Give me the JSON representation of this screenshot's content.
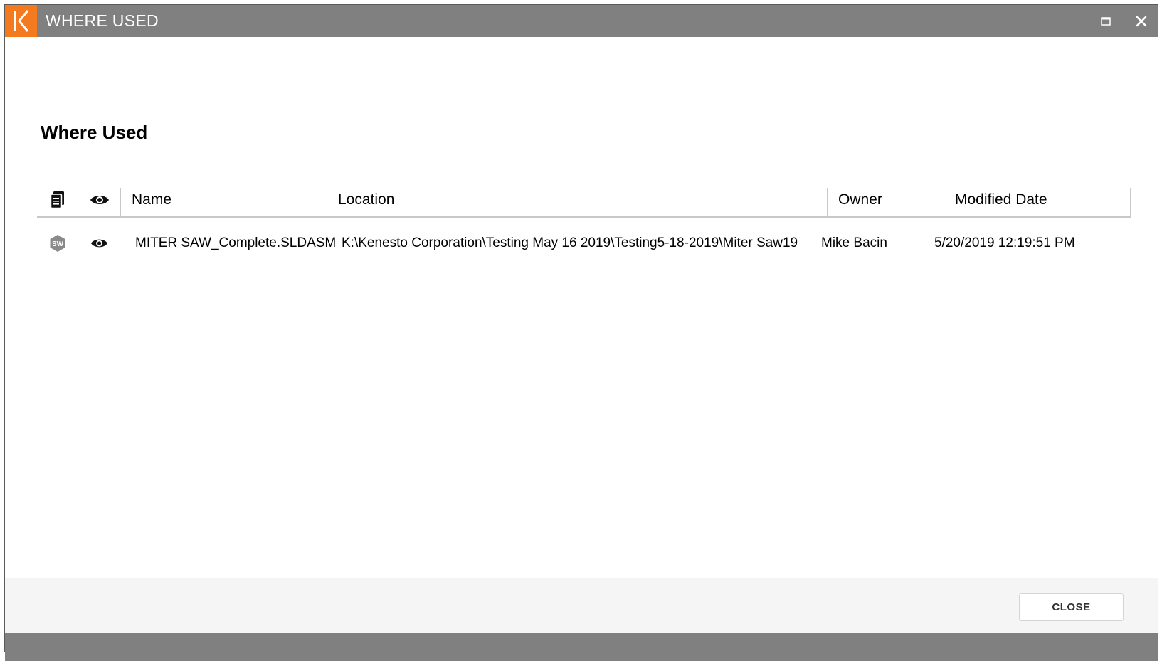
{
  "window": {
    "title": "WHERE USED",
    "logo_letter": "K",
    "brand_color": "#f47a20",
    "titlebar_color": "#808080"
  },
  "heading": "Where Used",
  "grid": {
    "columns": {
      "type_icon": "document-icon",
      "preview_icon": "eye-icon",
      "name": "Name",
      "location": "Location",
      "owner": "Owner",
      "modified": "Modified Date"
    },
    "rows": [
      {
        "type_icon": "solidworks-icon",
        "type_badge": "SW",
        "preview_icon": "eye-icon",
        "name": "MITER SAW_Complete.SLDASM",
        "location": "K:\\Kenesto Corporation\\Testing May 16 2019\\Testing5-18-2019\\Miter Saw19",
        "owner": "Mike Bacin",
        "modified": "5/20/2019 12:19:51 PM"
      }
    ]
  },
  "footer": {
    "close_label": "CLOSE"
  }
}
